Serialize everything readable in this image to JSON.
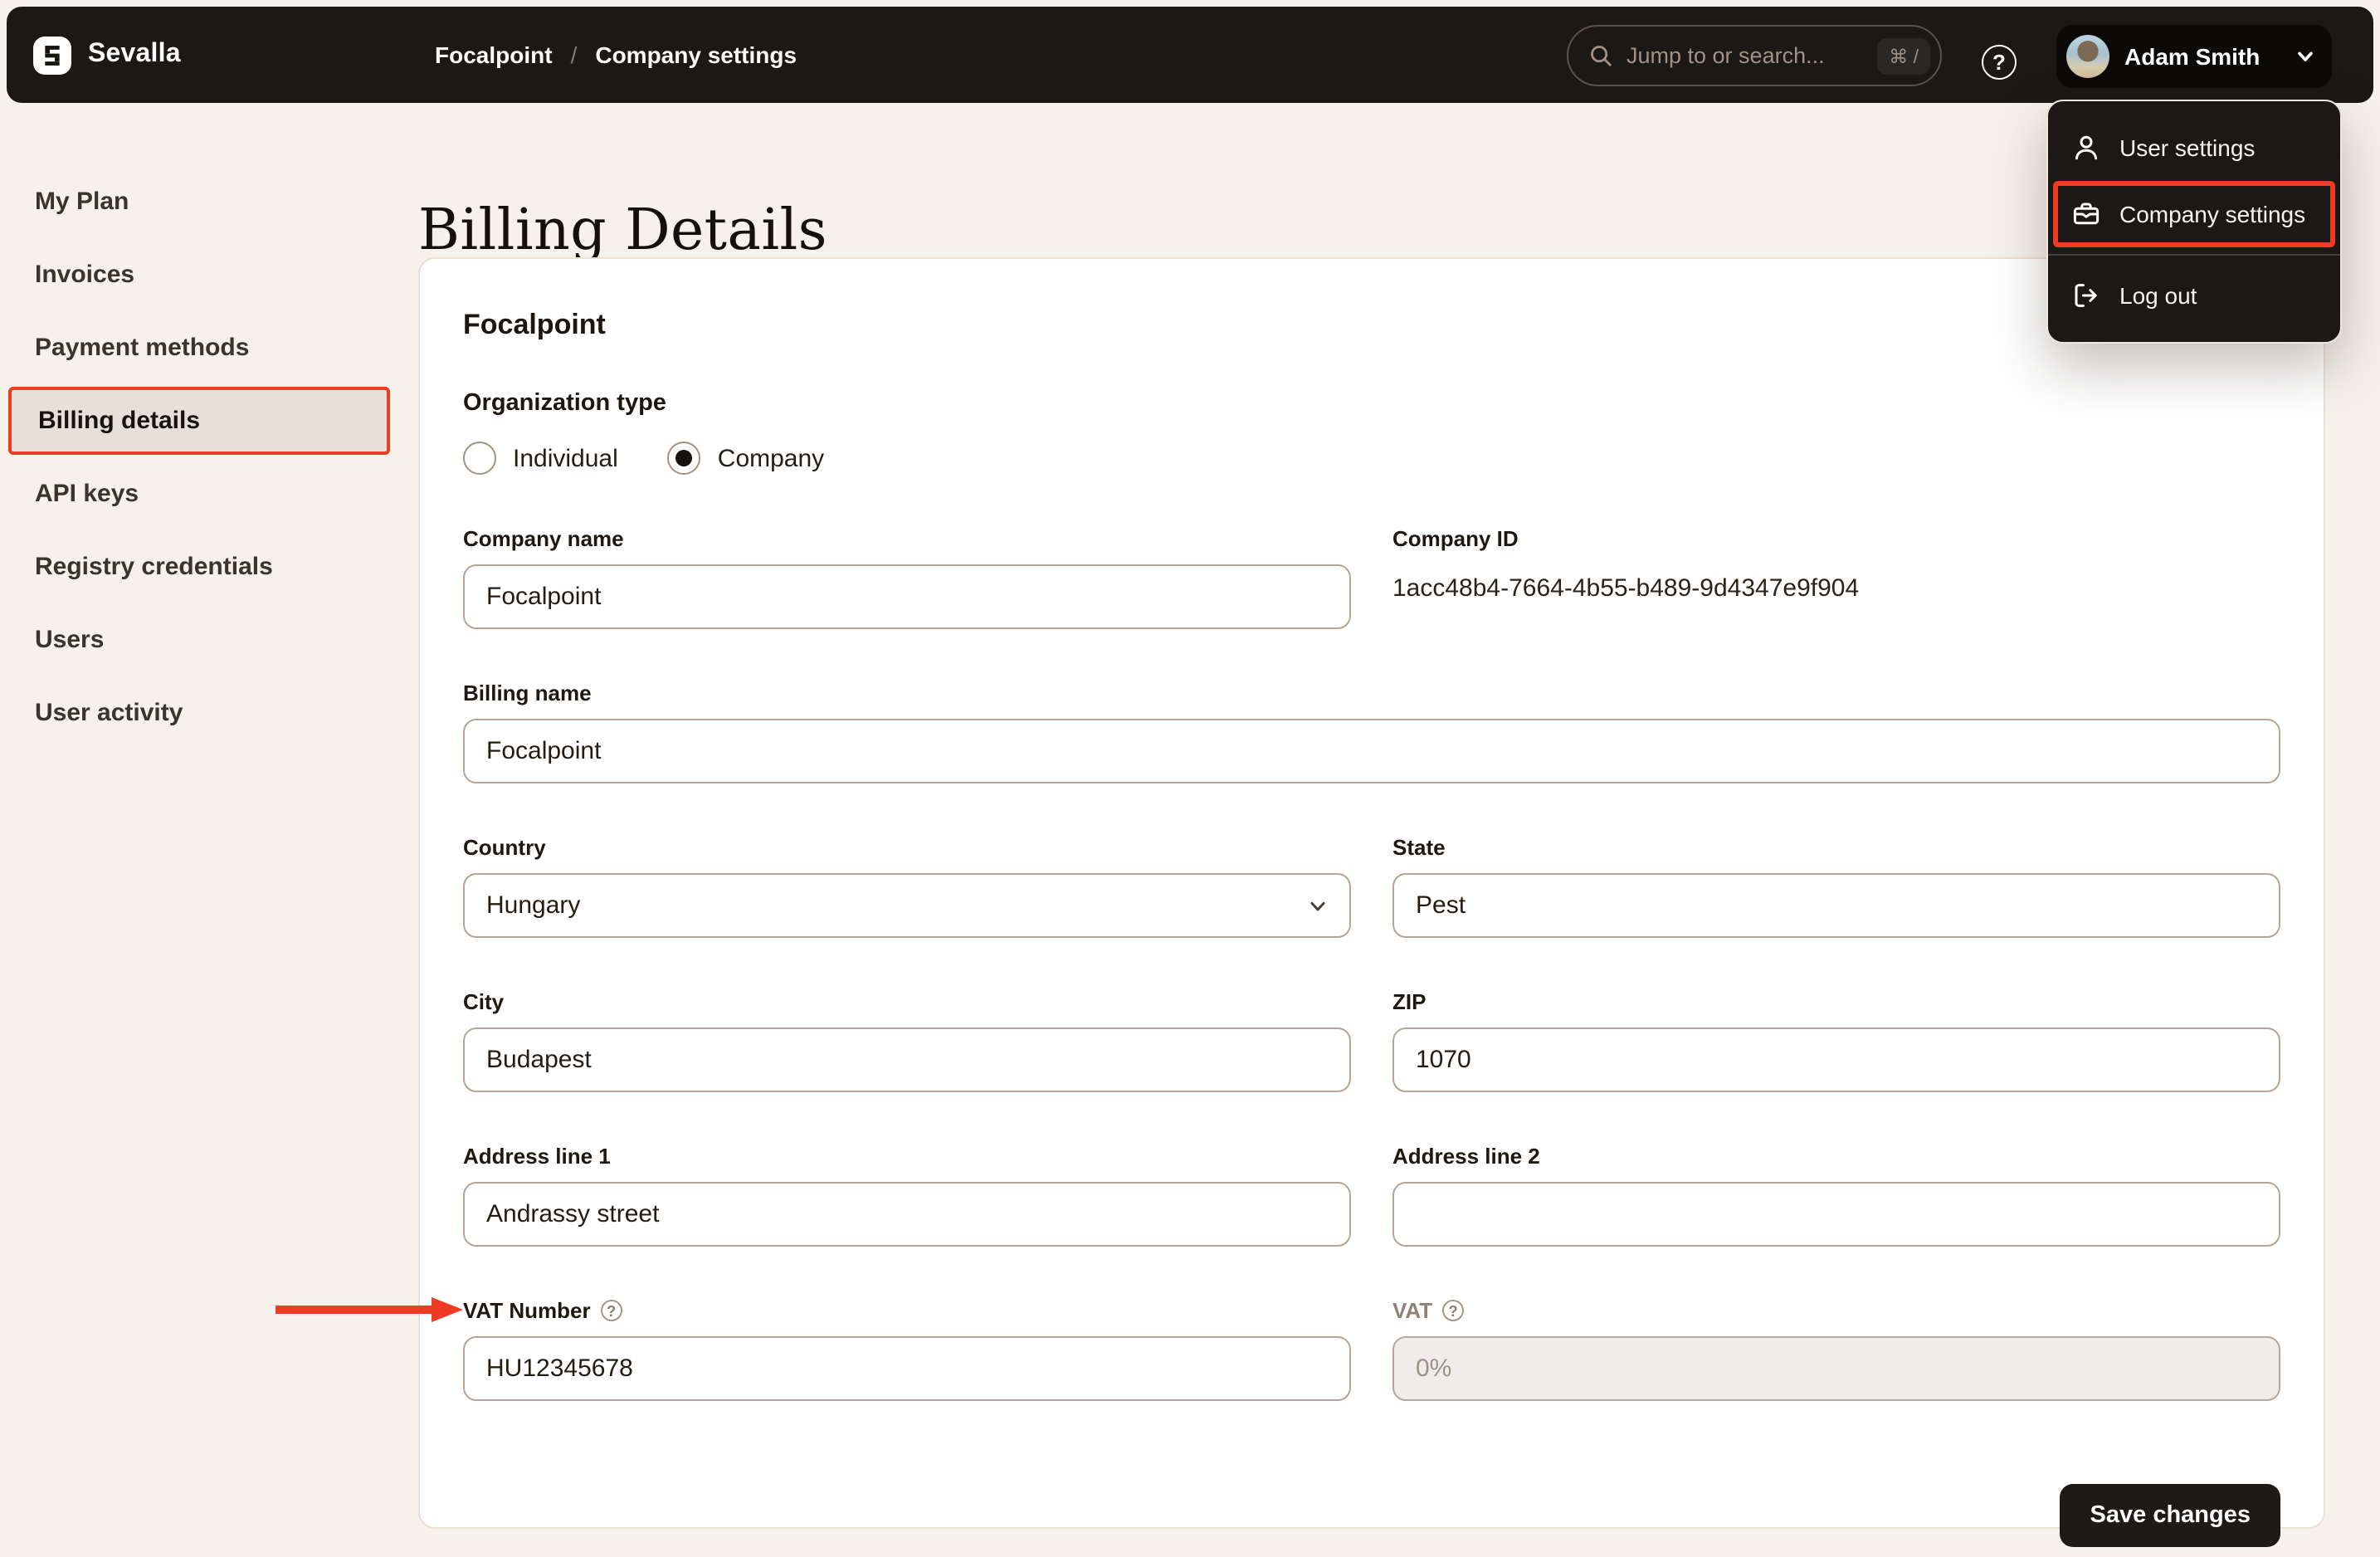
{
  "topbar": {
    "brand": "Sevalla",
    "breadcrumb": {
      "project": "Focalpoint",
      "separator": "/",
      "page": "Company settings"
    },
    "search": {
      "placeholder": "Jump to or search...",
      "shortcut": "⌘ /"
    },
    "help_glyph": "?",
    "user_name": "Adam Smith"
  },
  "user_menu": {
    "user_settings": "User settings",
    "company_settings": "Company settings",
    "log_out": "Log out"
  },
  "sidebar": {
    "items": [
      {
        "label": "My Plan"
      },
      {
        "label": "Invoices"
      },
      {
        "label": "Payment methods"
      },
      {
        "label": "Billing details"
      },
      {
        "label": "API keys"
      },
      {
        "label": "Registry credentials"
      },
      {
        "label": "Users"
      },
      {
        "label": "User activity"
      }
    ]
  },
  "page": {
    "title": "Billing Details"
  },
  "card": {
    "company_heading": "Focalpoint",
    "organization_type": {
      "label": "Organization type",
      "individual": "Individual",
      "company": "Company",
      "selected": "Company"
    },
    "fields": {
      "company_name": {
        "label": "Company name",
        "value": "Focalpoint"
      },
      "company_id": {
        "label": "Company ID",
        "value": "1acc48b4-7664-4b55-b489-9d4347e9f904"
      },
      "billing_name": {
        "label": "Billing name",
        "value": "Focalpoint"
      },
      "country": {
        "label": "Country",
        "value": "Hungary"
      },
      "state": {
        "label": "State",
        "value": "Pest"
      },
      "city": {
        "label": "City",
        "value": "Budapest"
      },
      "zip": {
        "label": "ZIP",
        "value": "1070"
      },
      "address_line_1": {
        "label": "Address line 1",
        "value": "Andrassy street"
      },
      "address_line_2": {
        "label": "Address line 2",
        "value": ""
      },
      "vat_number": {
        "label": "VAT Number",
        "value": "HU12345678",
        "help_glyph": "?"
      },
      "vat": {
        "label": "VAT",
        "value": "0%",
        "help_glyph": "?"
      }
    },
    "save_button": "Save changes"
  },
  "colors": {
    "accent_red": "#ee3b23",
    "topbar_bg": "#1b1816",
    "page_bg": "#f7f1ec",
    "card_bg": "#ffffff",
    "input_border": "#b6a496",
    "active_nav_bg": "#e8e0d8"
  }
}
